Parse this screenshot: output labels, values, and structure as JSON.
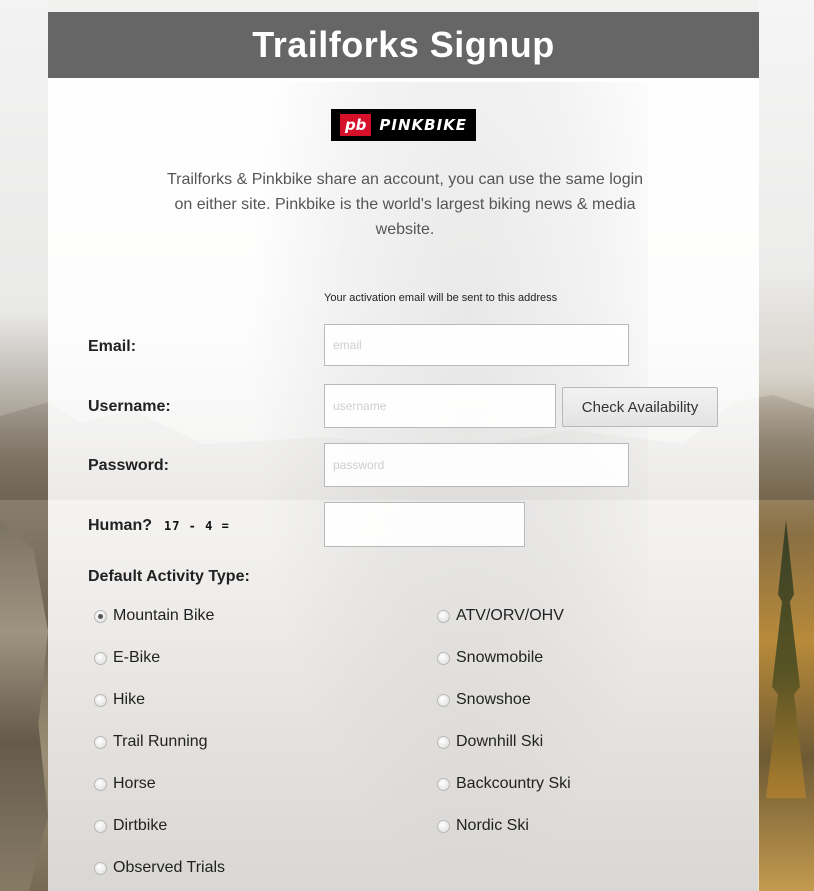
{
  "header": {
    "title": "Trailforks Signup"
  },
  "logo": {
    "badge": "pb",
    "wordmark": "PINKBIKE"
  },
  "intro": "Trailforks & Pinkbike share an account, you can use the same login on either site. Pinkbike is the world's largest biking news & media website.",
  "form": {
    "activation_note": "Your activation email will be sent to this address",
    "email": {
      "label": "Email:",
      "placeholder": "email",
      "value": ""
    },
    "username": {
      "label": "Username:",
      "placeholder": "username",
      "value": ""
    },
    "check_availability": "Check Availability",
    "password": {
      "label": "Password:",
      "placeholder": "password",
      "value": ""
    },
    "human": {
      "label": "Human?",
      "captcha": "17 - 4 =",
      "value": ""
    },
    "activity": {
      "label": "Default Activity Type:",
      "selected": "Mountain Bike",
      "options_left": [
        "Mountain Bike",
        "E-Bike",
        "Hike",
        "Trail Running",
        "Horse",
        "Dirtbike",
        "Observed Trials"
      ],
      "options_right": [
        "ATV/ORV/OHV",
        "Snowmobile",
        "Snowshoe",
        "Downhill Ski",
        "Backcountry Ski",
        "Nordic Ski"
      ]
    }
  },
  "colors": {
    "header_bg": "#666666",
    "header_text": "#ffffff",
    "logo_red": "#d7102a",
    "label_text": "#222222",
    "intro_text": "#555555"
  }
}
